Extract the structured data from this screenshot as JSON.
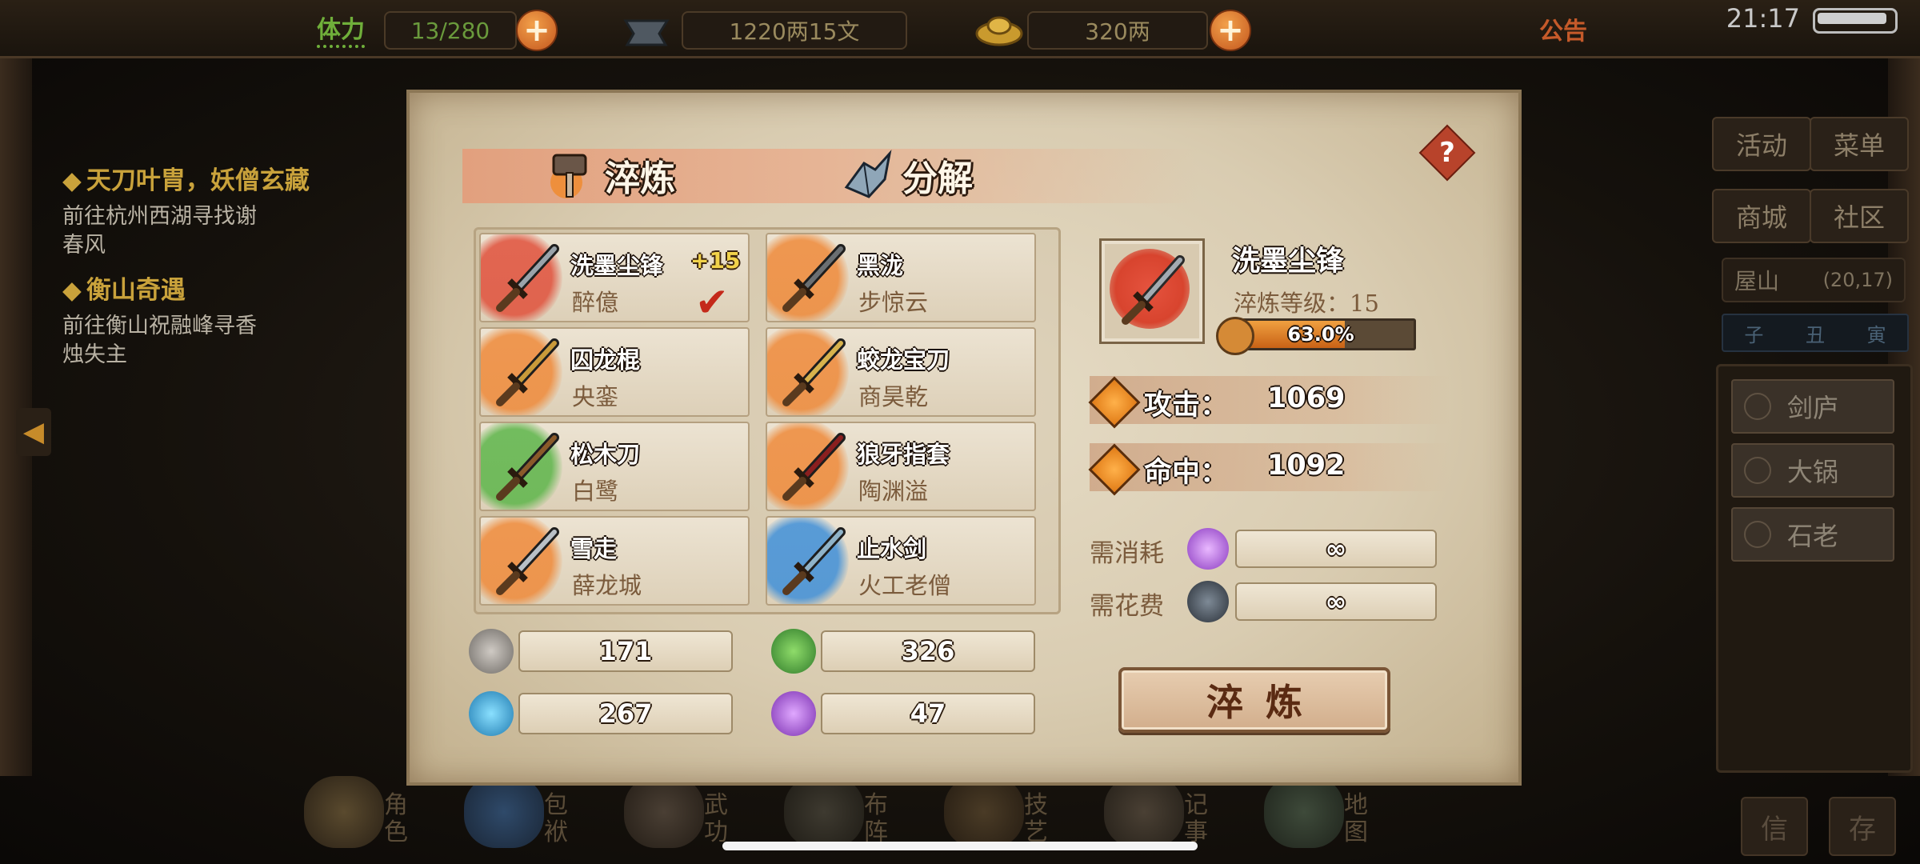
{
  "topbar": {
    "stamina_label": "体力",
    "stamina_value": "13/280",
    "silver_value": "1220两15文",
    "gold_value": "320两",
    "notice_label": "公告",
    "clock": "21:17"
  },
  "quests": [
    {
      "title": "天刀叶胄，妖僧玄藏",
      "desc_line1": "前往杭州西湖寻找谢",
      "desc_line2": "春风"
    },
    {
      "title": "衡山奇遇",
      "desc_line1": "前往衡山祝融峰寻香",
      "desc_line2": "烛失主"
    }
  ],
  "right_menu": {
    "activity": "活动",
    "menu": "菜单",
    "shop": "商城",
    "community": "社区",
    "location_name": "屋山",
    "location_coords": "(20,17)",
    "hours": [
      "子",
      "丑",
      "寅"
    ],
    "npcs": [
      "剑庐",
      "大锅",
      "石老"
    ],
    "bottom_buttons": [
      "信",
      "存"
    ]
  },
  "bottom_nav": [
    {
      "l1": "角",
      "l2": "色"
    },
    {
      "l1": "包",
      "l2": "袱"
    },
    {
      "l1": "武",
      "l2": "功"
    },
    {
      "l1": "布",
      "l2": "阵"
    },
    {
      "l1": "技",
      "l2": "艺"
    },
    {
      "l1": "记",
      "l2": "事"
    },
    {
      "l1": "地",
      "l2": "图"
    }
  ],
  "dialog": {
    "tab_refine": "淬炼",
    "tab_decompose": "分解",
    "help": "?",
    "items": [
      {
        "name": "洗墨尘锋",
        "owner": "醉億",
        "level": "+15",
        "selected": true,
        "splash": "#e0503b",
        "blade": "#9aa3aa"
      },
      {
        "name": "黑泷",
        "owner": "步惊云",
        "level": "",
        "selected": false,
        "splash": "#ef8a3a",
        "blade": "#6b6f72"
      },
      {
        "name": "囚龙棍",
        "owner": "央銮",
        "level": "",
        "selected": false,
        "splash": "#ef8a3a",
        "blade": "#c99a3a"
      },
      {
        "name": "蛟龙宝刀",
        "owner": "商昊乾",
        "level": "",
        "selected": false,
        "splash": "#ef8a3a",
        "blade": "#d7b24c"
      },
      {
        "name": "松木刀",
        "owner": "白鹭",
        "level": "",
        "selected": false,
        "splash": "#5db54a",
        "blade": "#8a5a2a"
      },
      {
        "name": "狼牙指套",
        "owner": "陶渊溢",
        "level": "",
        "selected": false,
        "splash": "#ef8a3a",
        "blade": "#8a1f1f"
      },
      {
        "name": "雪走",
        "owner": "薛龙城",
        "level": "",
        "selected": false,
        "splash": "#ef8a3a",
        "blade": "#b9c0c6"
      },
      {
        "name": "止水剑",
        "owner": "火工老僧",
        "level": "",
        "selected": false,
        "splash": "#3f8fd8",
        "blade": "#8fb3c9"
      }
    ],
    "resources": [
      {
        "value": "171",
        "color": "#9a9590"
      },
      {
        "value": "326",
        "color": "#4fa24a"
      },
      {
        "value": "267",
        "color": "#3aa5d8"
      },
      {
        "value": "47",
        "color": "#a75ad0"
      }
    ],
    "detail": {
      "name": "洗墨尘锋",
      "level_text": "淬炼等级：15",
      "progress_text": "63.0%",
      "progress": 0.63,
      "attack_label": "攻击：",
      "attack_value": "1069",
      "hit_label": "命中：",
      "hit_value": "1092",
      "consume_label": "需消耗",
      "consume_value": "∞",
      "cost_label": "需花费",
      "cost_value": "∞"
    },
    "refine_button": "淬炼"
  },
  "colors": {
    "accent_orange": "#e07b17",
    "gold_text": "#c9a23b",
    "parchment": "#e6dcc6"
  }
}
